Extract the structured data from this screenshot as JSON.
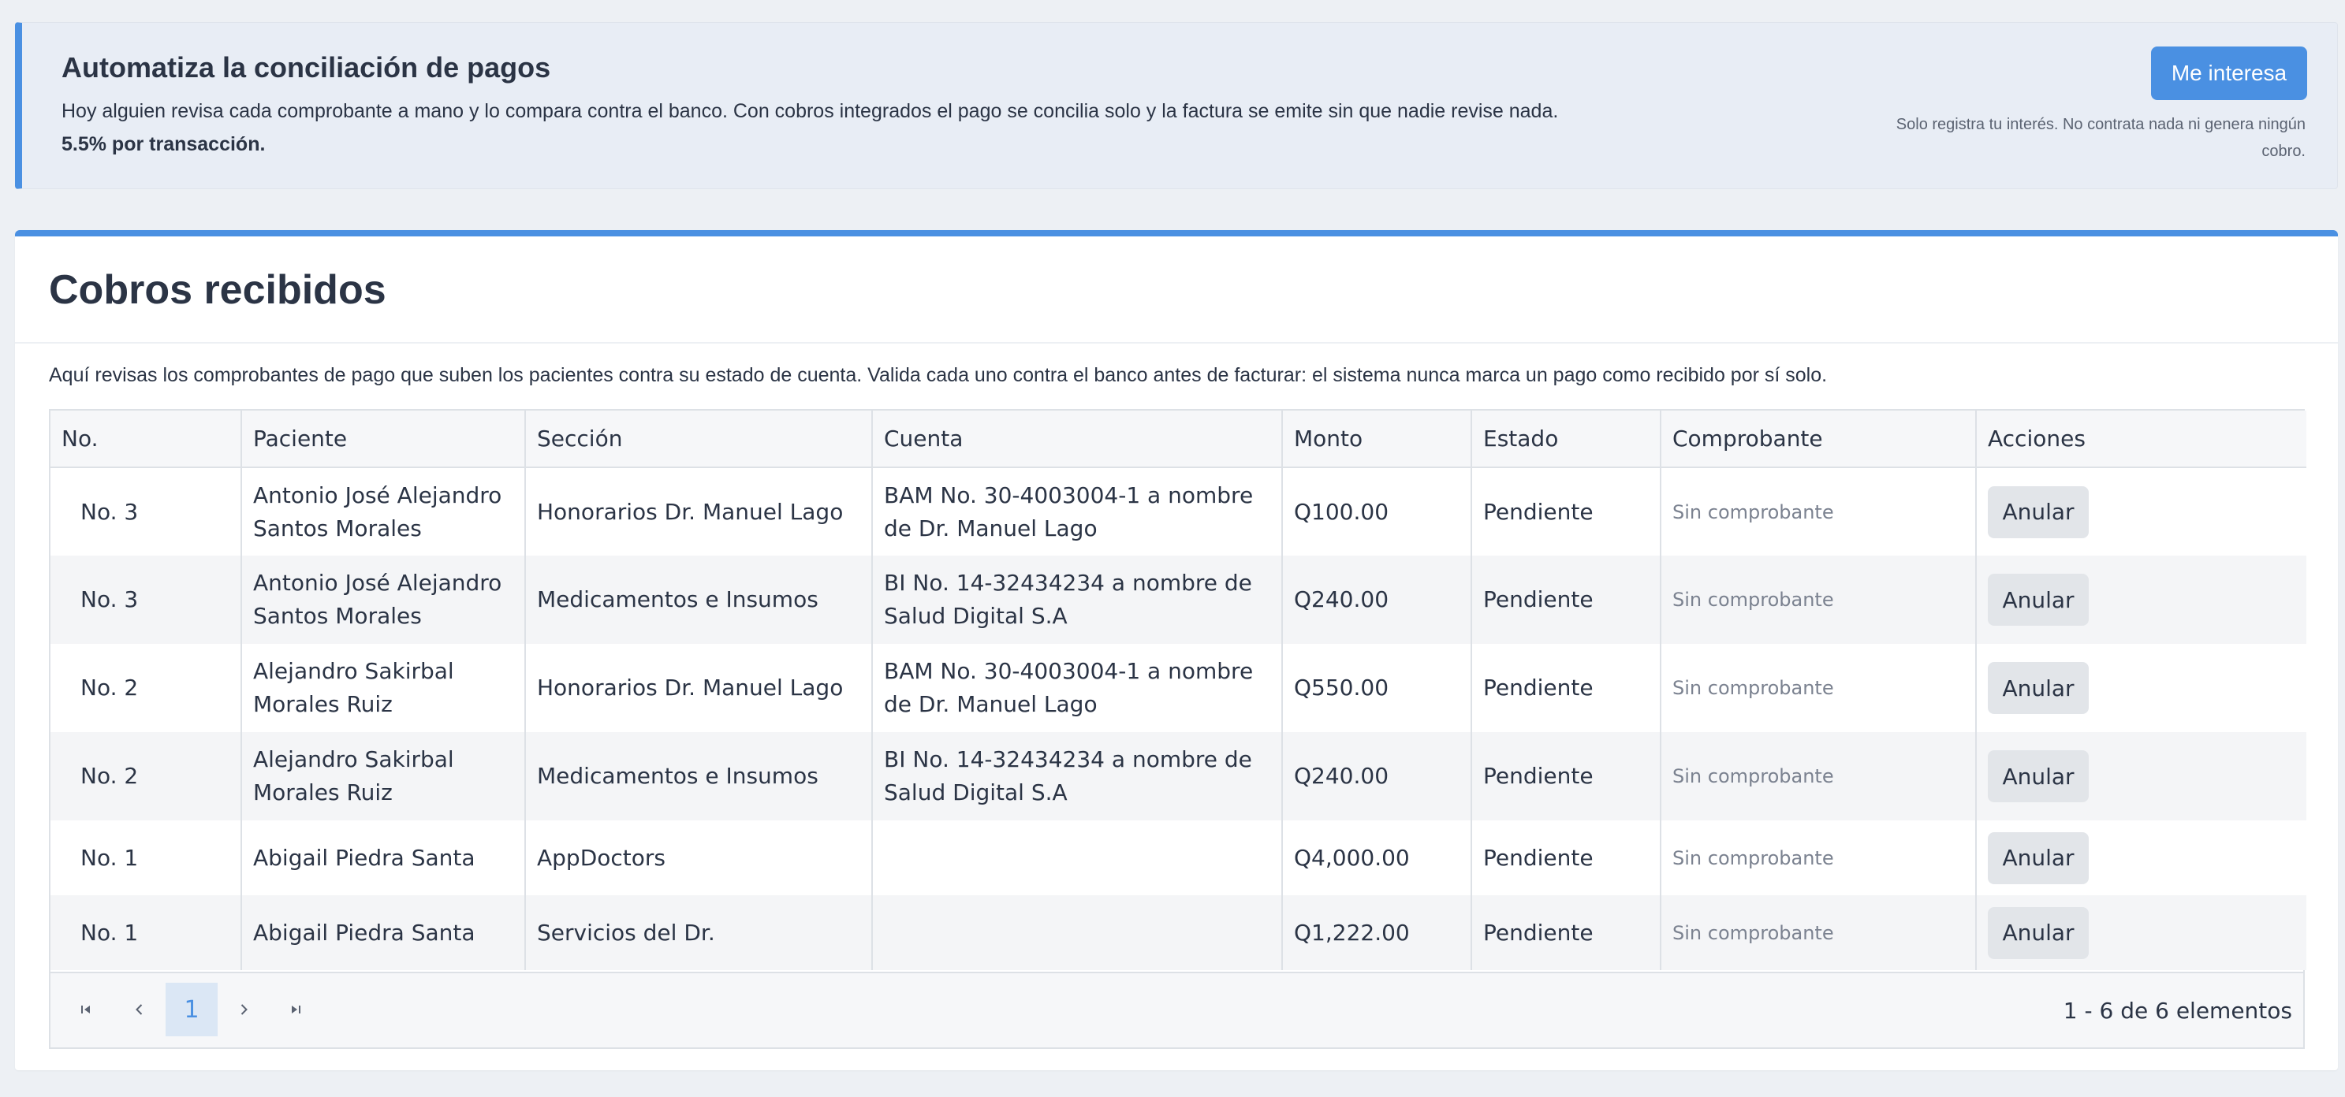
{
  "promo": {
    "title": "Automatiza la conciliación de pagos",
    "text": "Hoy alguien revisa cada comprobante a mano y lo compara contra el banco. Con cobros integrados el pago se concilia solo y la factura se emite sin que nadie revise nada.",
    "price": "5.5% por transacción.",
    "button_label": "Me interesa",
    "note": "Solo registra tu interés. No contrata nada ni genera ningún cobro."
  },
  "main": {
    "title": "Cobros recibidos",
    "description": "Aquí revisas los comprobantes de pago que suben los pacientes contra su estado de cuenta. Valida cada uno contra el banco antes de facturar: el sistema nunca marca un pago como recibido por sí solo."
  },
  "table": {
    "columns": [
      "No.",
      "Paciente",
      "Sección",
      "Cuenta",
      "Monto",
      "Estado",
      "Comprobante",
      "Acciones"
    ],
    "rows": [
      {
        "no": "No. 3",
        "patient": "Antonio José Alejandro Santos Morales",
        "section": "Honorarios Dr. Manuel Lago",
        "account": "BAM No. 30-4003004-1 a nombre de Dr. Manuel Lago",
        "amount": "Q100.00",
        "status": "Pendiente",
        "voucher": "Sin comprobante",
        "action": "Anular"
      },
      {
        "no": "No. 3",
        "patient": "Antonio José Alejandro Santos Morales",
        "section": "Medicamentos e Insumos",
        "account": "BI No. 14-32434234 a nombre de Salud Digital S.A",
        "amount": "Q240.00",
        "status": "Pendiente",
        "voucher": "Sin comprobante",
        "action": "Anular"
      },
      {
        "no": "No. 2",
        "patient": "Alejandro Sakirbal Morales Ruiz",
        "section": "Honorarios Dr. Manuel Lago",
        "account": "BAM No. 30-4003004-1 a nombre de Dr. Manuel Lago",
        "amount": "Q550.00",
        "status": "Pendiente",
        "voucher": "Sin comprobante",
        "action": "Anular"
      },
      {
        "no": "No. 2",
        "patient": "Alejandro Sakirbal Morales Ruiz",
        "section": "Medicamentos e Insumos",
        "account": "BI No. 14-32434234 a nombre de Salud Digital S.A",
        "amount": "Q240.00",
        "status": "Pendiente",
        "voucher": "Sin comprobante",
        "action": "Anular"
      },
      {
        "no": "No. 1",
        "patient": "Abigail Piedra Santa",
        "section": "AppDoctors",
        "account": "",
        "amount": "Q4,000.00",
        "status": "Pendiente",
        "voucher": "Sin comprobante",
        "action": "Anular"
      },
      {
        "no": "No. 1",
        "patient": "Abigail Piedra Santa",
        "section": "Servicios del Dr.",
        "account": "",
        "amount": "Q1,222.00",
        "status": "Pendiente",
        "voucher": "Sin comprobante",
        "action": "Anular"
      }
    ]
  },
  "pager": {
    "first_icon": "first-page-icon",
    "prev_icon": "chevron-left-icon",
    "current_page": "1",
    "next_icon": "chevron-right-icon",
    "last_icon": "last-page-icon",
    "info": "1 - 6 de 6 elementos"
  },
  "colors": {
    "accent": "#4a90e2",
    "banner_bg": "#e8edf5",
    "page_bg": "#edf0f4",
    "button_secondary": "#e2e5e9"
  }
}
